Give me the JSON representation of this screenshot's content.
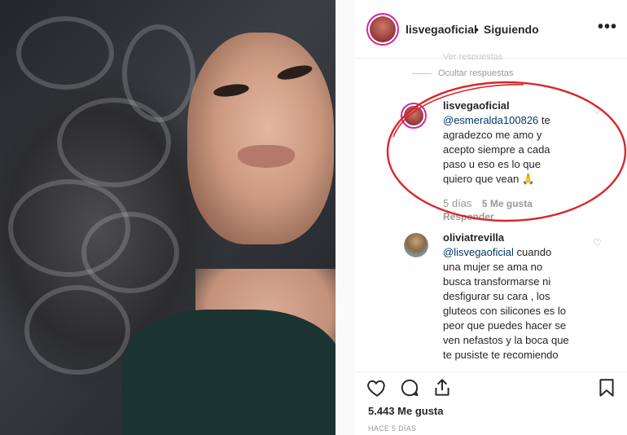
{
  "header": {
    "username": "lisvegaoficial",
    "separator": "•",
    "follow_status": "Siguiendo",
    "more_label": "•••"
  },
  "thread": {
    "hidden_preview": "Ver respuestas",
    "hide_replies_label": "Ocultar respuestas"
  },
  "comments": [
    {
      "username": "lisvegaoficial",
      "mention": "@esmeralda100826",
      "text_lines": [
        "te",
        "agradezco me amo y",
        "acepto siempre a cada",
        "paso u eso es lo que",
        "quiero que vean 🙏"
      ],
      "age": "5 días",
      "likes": "5 Me gusta",
      "reply_label": "Responder"
    },
    {
      "username": "oliviatrevilla",
      "mention": "@lisvegaoficial",
      "text_lines": [
        "cuando",
        "una mujer se ama no",
        "busca transformarse ni",
        "desfigurar su cara , los",
        "gluteos con silicones es lo",
        "peor que puedes hacer se",
        "ven nefastos y la boca que",
        "te pusiste te recomiendo"
      ]
    }
  ],
  "actions": {
    "like_icon": "heart-icon",
    "comment_icon": "comment-icon",
    "share_icon": "share-icon",
    "save_icon": "bookmark-icon"
  },
  "likes_count": "5.443 Me gusta",
  "posted_ago": "HACE 5 DÍAS",
  "colors": {
    "annotation": "#d9262b",
    "mention": "#00376b",
    "muted": "#999999"
  }
}
